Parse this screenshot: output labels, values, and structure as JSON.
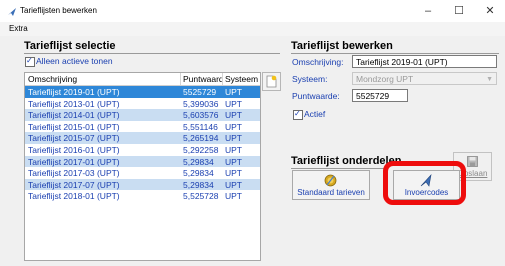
{
  "window": {
    "title": "Tarieflijsten bewerken",
    "controls": [
      "–",
      "☐",
      "✕"
    ]
  },
  "menu": {
    "extra": "Extra"
  },
  "left": {
    "title": "Tarieflijst selectie",
    "active_only_label": "Alleen actieve tonen",
    "active_only_checked": true,
    "columns": [
      "Omschrijving",
      "Puntwaarde",
      "Systeem"
    ],
    "rows": [
      {
        "omschrijving": "Tarieflijst 2019-01 (UPT)",
        "puntwaarde": "5525729",
        "systeem": "UPT",
        "state": "selected"
      },
      {
        "omschrijving": "Tarieflijst 2013-01 (UPT)",
        "puntwaarde": "5,399036",
        "systeem": "UPT",
        "state": "normal"
      },
      {
        "omschrijving": "Tarieflijst 2014-01 (UPT)",
        "puntwaarde": "5,603576",
        "systeem": "UPT",
        "state": "alt"
      },
      {
        "omschrijving": "Tarieflijst 2015-01 (UPT)",
        "puntwaarde": "5,551146",
        "systeem": "UPT",
        "state": "normal"
      },
      {
        "omschrijving": "Tarieflijst 2015-07 (UPT)",
        "puntwaarde": "5,265194",
        "systeem": "UPT",
        "state": "alt"
      },
      {
        "omschrijving": "Tarieflijst 2016-01 (UPT)",
        "puntwaarde": "5,292258",
        "systeem": "UPT",
        "state": "normal"
      },
      {
        "omschrijving": "Tarieflijst 2017-01 (UPT)",
        "puntwaarde": "5,29834",
        "systeem": "UPT",
        "state": "alt"
      },
      {
        "omschrijving": "Tarieflijst 2017-03 (UPT)",
        "puntwaarde": "5,29834",
        "systeem": "UPT",
        "state": "normal"
      },
      {
        "omschrijving": "Tarieflijst 2017-07 (UPT)",
        "puntwaarde": "5,29834",
        "systeem": "UPT",
        "state": "alt"
      },
      {
        "omschrijving": "Tarieflijst 2018-01 (UPT)",
        "puntwaarde": "5,525728",
        "systeem": "UPT",
        "state": "normal"
      }
    ]
  },
  "right": {
    "title": "Tarieflijst bewerken",
    "omschrijving_label": "Omschrijving:",
    "omschrijving_value": "Tarieflijst 2019-01 (UPT)",
    "systeem_label": "Systeem:",
    "systeem_value": "Mondzorg UPT",
    "puntwaarde_label": "Puntwaarde:",
    "puntwaarde_value": "5525729",
    "actief_label": "Actief",
    "actief_checked": true,
    "save_label": "Opslaan",
    "onderdelen_title": "Tarieflijst onderdelen",
    "standaard_label": "Standaard tarieven",
    "invoercodes_label": "Invoercodes"
  },
  "colors": {
    "label_blue": "#1a3fb0",
    "selected_row": "#2e87d8",
    "alt_row": "#c9ddf2",
    "highlight": "#ee0d0d"
  }
}
